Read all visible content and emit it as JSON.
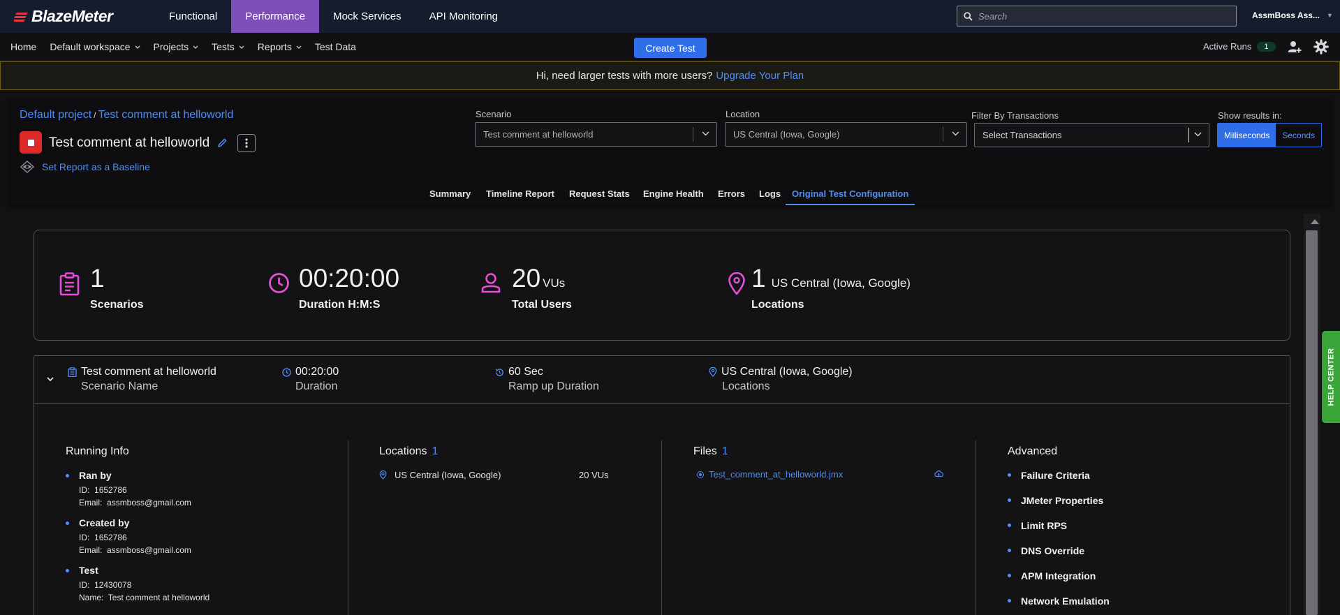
{
  "app": {
    "logo_text": "BlazeMeter"
  },
  "topnav": {
    "products": [
      "Functional",
      "Performance",
      "Mock Services",
      "API Monitoring"
    ],
    "active_product": "Performance",
    "search_placeholder": "Search",
    "user": "AssmBoss Ass..."
  },
  "subnav": {
    "items": [
      "Home",
      "Default workspace",
      "Projects",
      "Tests",
      "Reports",
      "Test Data"
    ],
    "create_test": "Create Test",
    "active_runs_label": "Active Runs",
    "active_runs_count": "1"
  },
  "banner": {
    "text": "Hi, need larger tests with more users?",
    "link": "Upgrade Your Plan"
  },
  "report": {
    "breadcrumb_project": "Default project",
    "breadcrumb_sep": "/",
    "breadcrumb_test": "Test comment at helloworld",
    "title": "Test comment at helloworld",
    "baseline_link": "Set Report as a Baseline"
  },
  "filters": {
    "scenario_label": "Scenario",
    "scenario_value": "Test comment at helloworld",
    "location_label": "Location",
    "location_value": "US Central (Iowa, Google)",
    "transactions_label": "Filter By Transactions",
    "transactions_placeholder": "Select Transactions",
    "show_results_label": "Show results in:",
    "unit_ms": "Milliseconds",
    "unit_s": "Seconds",
    "active_unit": "Milliseconds"
  },
  "tabs": [
    "Summary",
    "Timeline Report",
    "Request Stats",
    "Engine Health",
    "Errors",
    "Logs",
    "Original Test Configuration"
  ],
  "active_tab": "Original Test Configuration",
  "summary": {
    "scenarios_value": "1",
    "scenarios_label": "Scenarios",
    "duration_value": "00:20:00",
    "duration_label": "Duration H:M:S",
    "users_value": "20",
    "users_unit": "VUs",
    "users_label": "Total Users",
    "locations_value": "1",
    "locations_detail": "US Central (Iowa, Google)",
    "locations_label": "Locations"
  },
  "scenario": {
    "name": "Test comment at helloworld",
    "name_label": "Scenario Name",
    "duration": "00:20:00",
    "duration_label": "Duration",
    "ramp_up": "60 Sec",
    "ramp_up_label": "Ramp up Duration",
    "location": "US Central (Iowa, Google)",
    "location_label": "Locations"
  },
  "running_info": {
    "title": "Running Info",
    "items": [
      {
        "title": "Ran by",
        "id_label": "ID:",
        "id": "1652786",
        "second_label": "Email:",
        "second": "assmboss@gmail.com"
      },
      {
        "title": "Created by",
        "id_label": "ID:",
        "id": "1652786",
        "second_label": "Email:",
        "second": "assmboss@gmail.com"
      },
      {
        "title": "Test",
        "id_label": "ID:",
        "id": "12430078",
        "second_label": "Name:",
        "second": "Test comment at helloworld"
      }
    ]
  },
  "locations_section": {
    "title": "Locations",
    "count": "1",
    "location": "US Central (Iowa, Google)",
    "vus": "20 VUs"
  },
  "files_section": {
    "title": "Files",
    "count": "1",
    "file": "Test_comment_at_helloworld.jmx"
  },
  "advanced": {
    "title": "Advanced",
    "items": [
      "Failure Criteria",
      "JMeter Properties",
      "Limit RPS",
      "DNS Override",
      "APM Integration",
      "Network Emulation"
    ]
  },
  "help_center": "HELP CENTER",
  "colors": {
    "accent": "#2f6ee8",
    "link": "#4e8ef5",
    "active_product": "#7e4fb8",
    "icon_pink": "#e44fd8",
    "stop": "#e02a2a",
    "help": "#3aa63a"
  }
}
